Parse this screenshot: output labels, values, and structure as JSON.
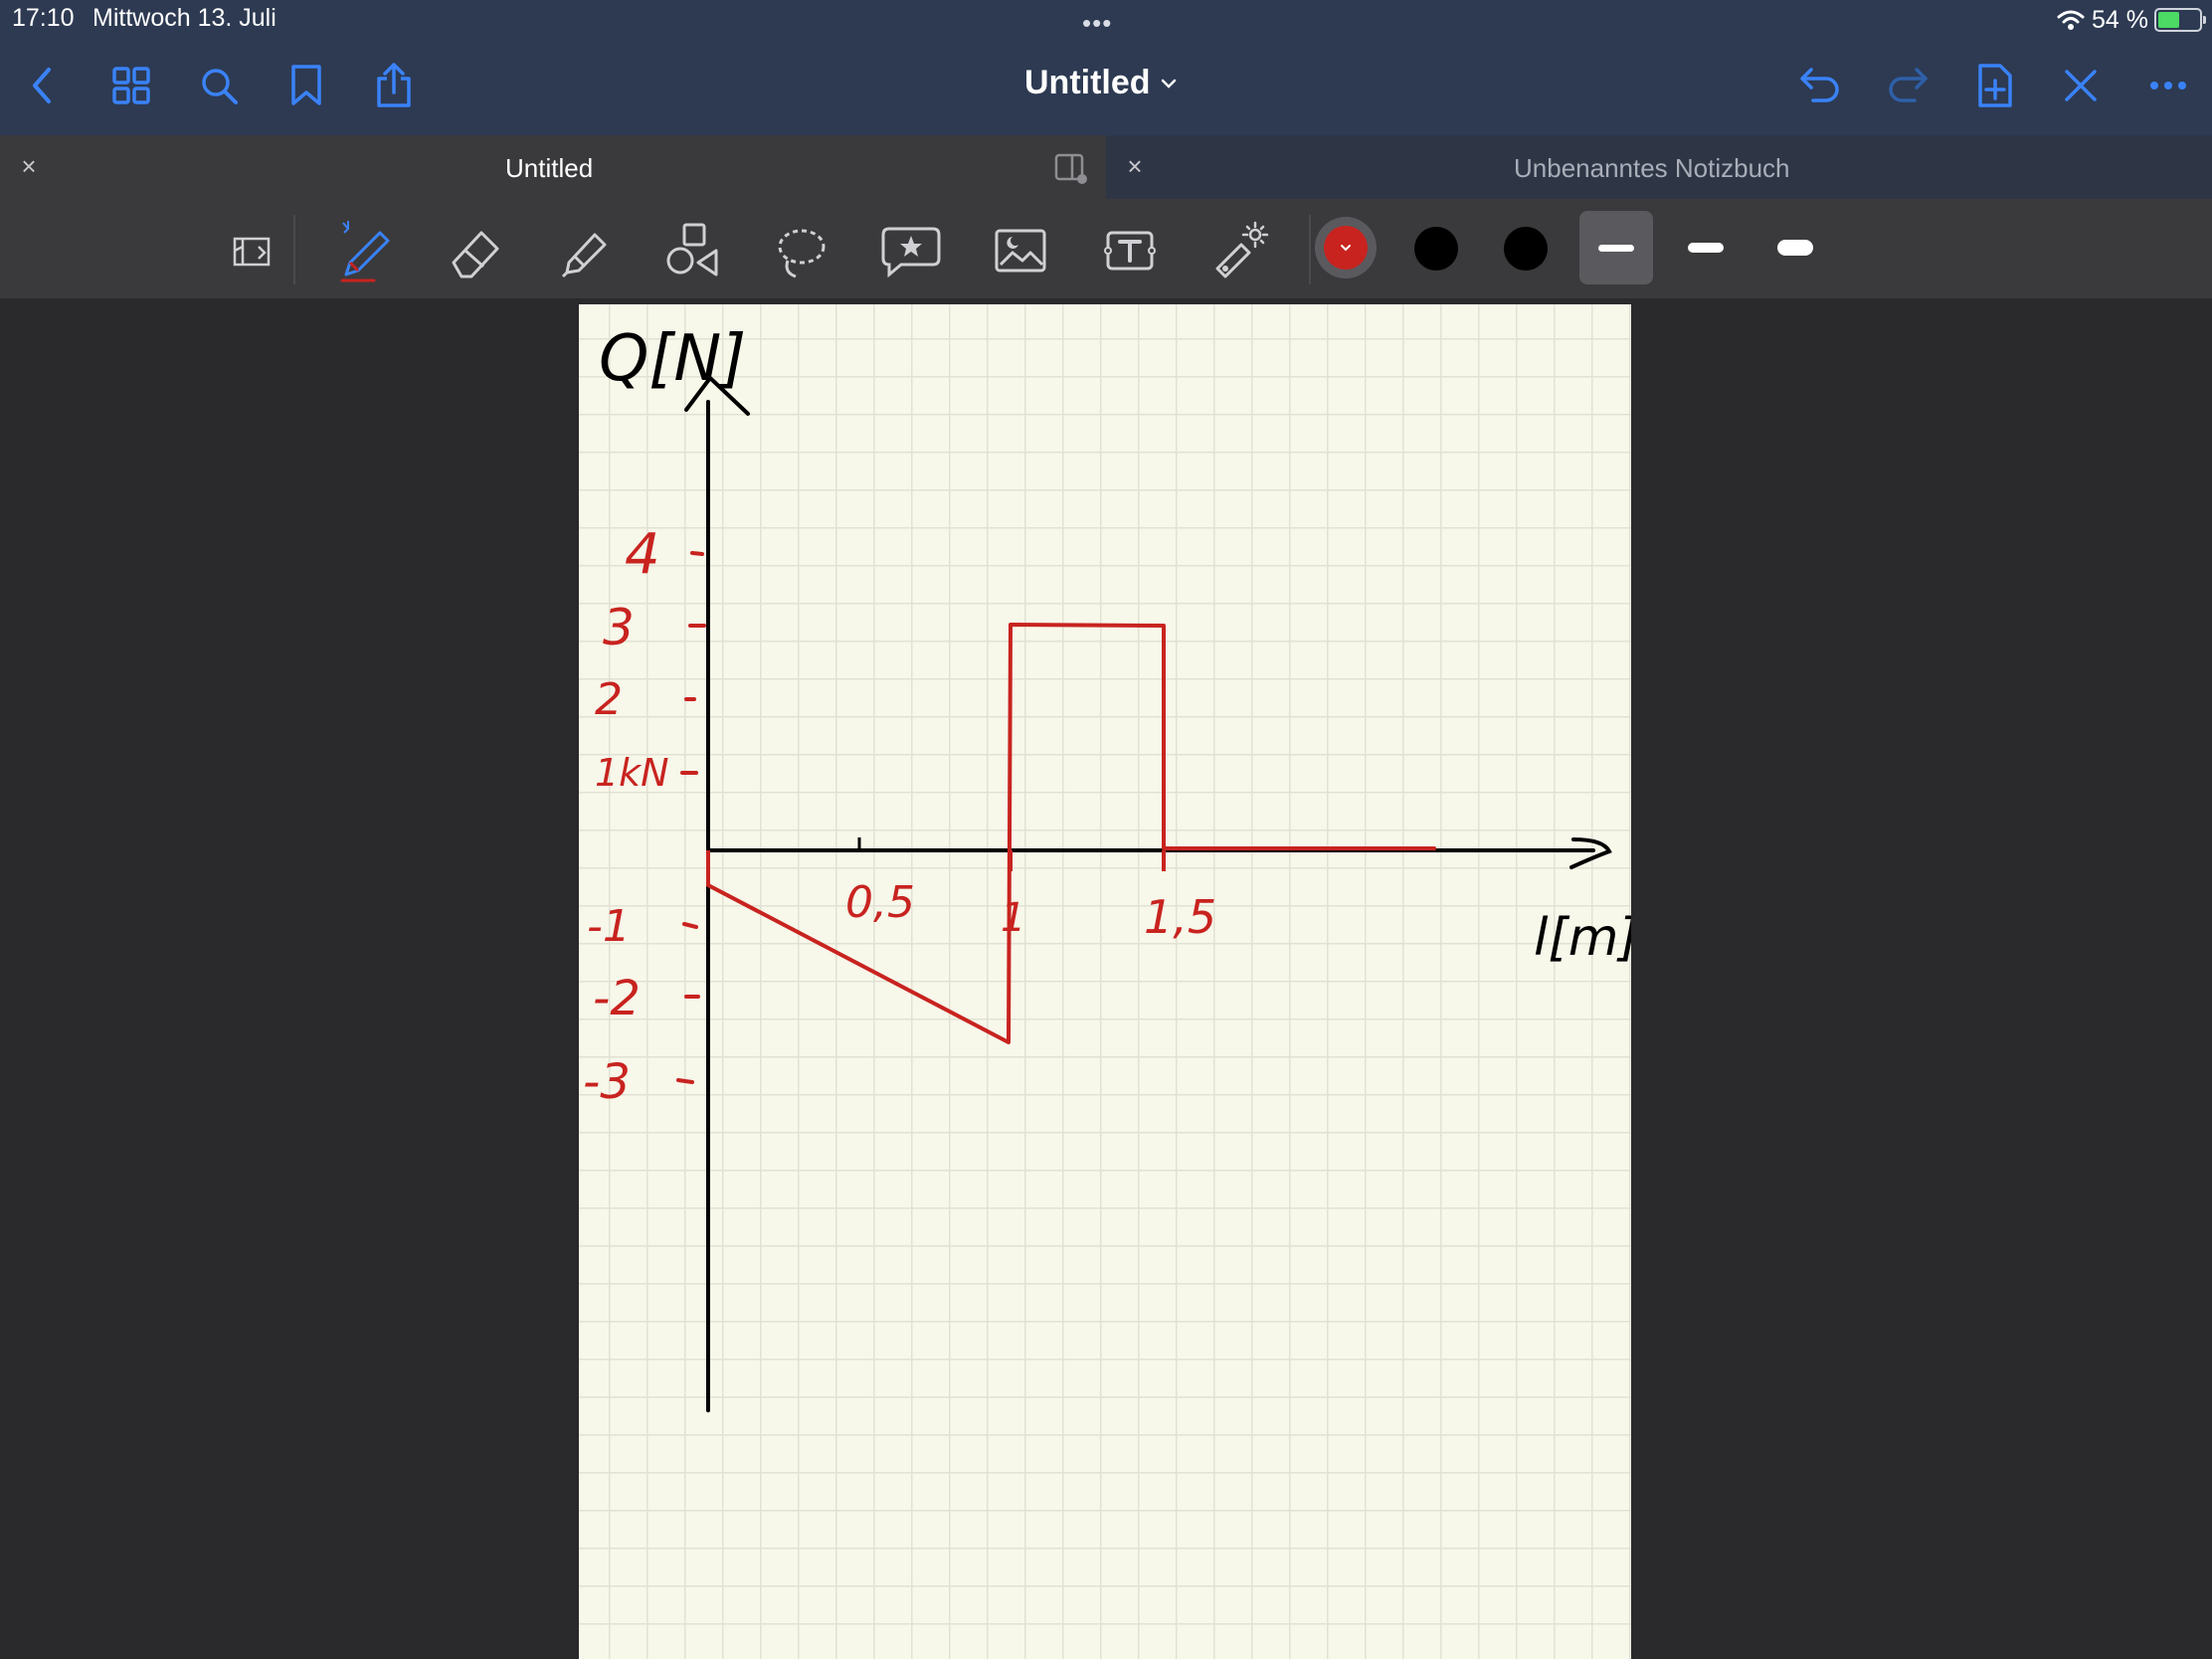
{
  "status_bar": {
    "time": "17:10",
    "date": "Mittwoch 13. Juli",
    "dots": "•••",
    "battery_percent": "54 %",
    "battery_level": 0.54
  },
  "nav": {
    "title": "Untitled",
    "left_icons": [
      "back-icon",
      "grid-icon",
      "search-icon",
      "bookmark-icon",
      "share-icon"
    ],
    "right_icons": [
      "undo-icon",
      "redo-icon",
      "add-page-icon",
      "close-toolbar-icon",
      "more-icon"
    ]
  },
  "tabs": [
    {
      "label": "Untitled",
      "active": true
    },
    {
      "label": "Unbenanntes Notizbuch",
      "active": false
    }
  ],
  "tab_close_glyph": "×",
  "toolbar": {
    "tools": [
      "read-mode-icon",
      "pen-icon",
      "eraser-icon",
      "highlighter-icon",
      "shapes-icon",
      "lasso-icon",
      "sticker-icon",
      "image-icon",
      "text-icon",
      "laser-pointer-icon"
    ],
    "selected_tool": "pen",
    "colors": [
      "#c8231f",
      "#000000",
      "#000000"
    ],
    "selected_color": "#c8231f",
    "stroke_widths": [
      "thin",
      "medium",
      "thick"
    ],
    "selected_stroke": "thin"
  },
  "notes": {
    "y_axis_label": "Q[N]",
    "x_axis_label": "l[m]",
    "y_ticks": [
      "4",
      "3",
      "2",
      "1kN",
      "-1",
      "-2",
      "-3"
    ],
    "x_ticks": [
      "0,5",
      "1",
      "1,5"
    ]
  },
  "colors": {
    "bar_bg": "#2d3a52",
    "toolbar_bg": "#3a3a3c",
    "accent_blue": "#3a82f7",
    "ink_red": "#c8231f",
    "ink_black": "#000000",
    "paper": "#f7f7ea"
  }
}
